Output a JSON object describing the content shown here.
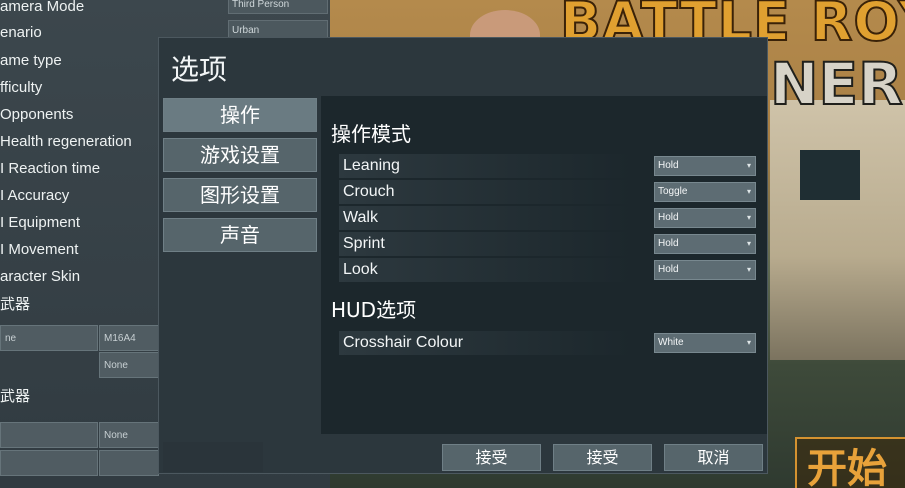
{
  "background": {
    "left_settings": [
      {
        "label": "amera Mode",
        "value": "Third Person"
      },
      {
        "label": "enario",
        "value": "Urban"
      },
      {
        "label": "ame type",
        "value": ""
      },
      {
        "label": "fficulty",
        "value": ""
      },
      {
        "label": "Opponents",
        "value": ""
      },
      {
        "label": "Health regeneration",
        "value": ""
      },
      {
        "label": "I Reaction time",
        "value": ""
      },
      {
        "label": "I Accuracy",
        "value": ""
      },
      {
        "label": "I Equipment",
        "value": ""
      },
      {
        "label": "I Movement",
        "value": ""
      },
      {
        "label": "aracter Skin",
        "value": ""
      }
    ],
    "weapon_header_1": "武器",
    "weapon_slot_1a": "ne",
    "weapon_slot_1b": "M16A4",
    "weapon_slot_1c": "None",
    "weapon_header_2": "武器",
    "weapon_slot_2a": "None",
    "art_title": "BATTLE ROYAL",
    "art_subtitle": "NER",
    "start_label": "开始"
  },
  "dialog": {
    "title": "选项",
    "nav": [
      {
        "label": "操作",
        "active": true
      },
      {
        "label": "游戏设置",
        "active": false
      },
      {
        "label": "图形设置",
        "active": false
      },
      {
        "label": "声音",
        "active": false
      }
    ],
    "sections": {
      "control_mode": {
        "title": "操作模式",
        "rows": [
          {
            "label": "Leaning",
            "value": "Hold"
          },
          {
            "label": "Crouch",
            "value": "Toggle"
          },
          {
            "label": "Walk",
            "value": "Hold"
          },
          {
            "label": "Sprint",
            "value": "Hold"
          },
          {
            "label": "Look",
            "value": "Hold"
          }
        ]
      },
      "hud": {
        "title": "HUD选项",
        "rows": [
          {
            "label": "Crosshair Colour",
            "value": "White"
          }
        ]
      }
    },
    "footer": {
      "accept_label": "接受",
      "apply_label": "接受",
      "cancel_label": "取消"
    }
  }
}
